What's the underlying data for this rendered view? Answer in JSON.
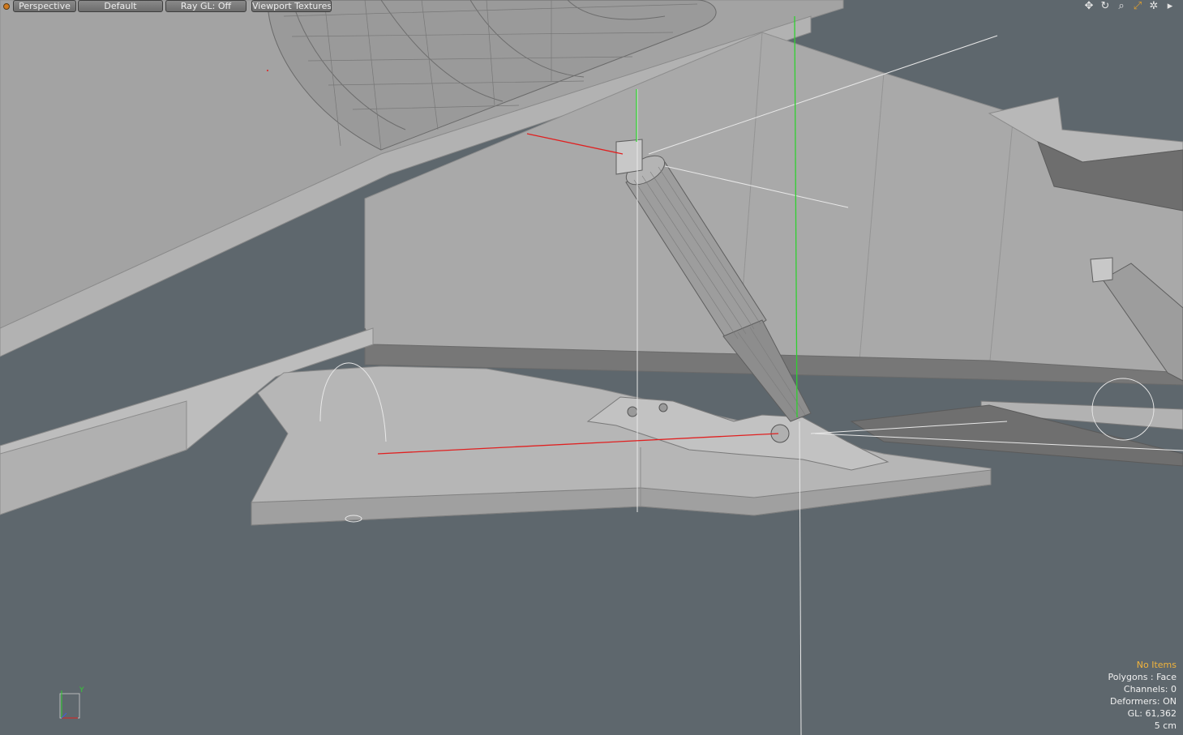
{
  "toolbar": {
    "view_menu": "Perspective",
    "style_menu": "Default",
    "raygl_toggle": "Ray GL: Off",
    "textures_toggle": "Viewport Textures",
    "icons": [
      "move-view-icon",
      "rotate-view-icon",
      "zoom-view-icon",
      "maximize-view-icon",
      "settings-icon",
      "expand-arrow-icon"
    ]
  },
  "info": {
    "selection": "No Items",
    "mode": "Polygons : Face",
    "channels": "Channels: 0",
    "deformers": "Deformers: ON",
    "gl_count": "GL: 61,362",
    "grid_size": "5 cm"
  },
  "axis_gizmo": {
    "up_label": "Y"
  },
  "colors": {
    "background": "#5e676d",
    "mesh": "#a7a7a7",
    "wire": "#8a8a8a",
    "x_axis": "#e02020",
    "y_axis": "#30d030",
    "highlight": "#f2b43c"
  }
}
